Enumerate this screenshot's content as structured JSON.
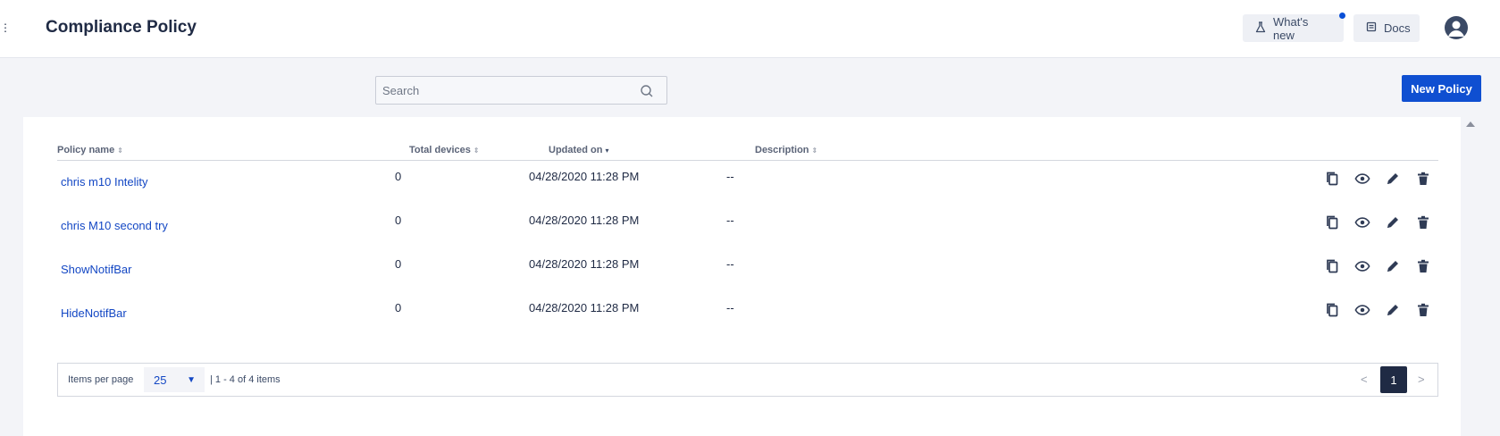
{
  "header": {
    "title": "Compliance Policy",
    "whats_new_label": "What's new",
    "docs_label": "Docs"
  },
  "toolbar": {
    "search_placeholder": "Search",
    "search_value": "",
    "new_policy_label": "New Policy"
  },
  "table": {
    "columns": [
      {
        "label": "Policy name",
        "sort": "none"
      },
      {
        "label": "Total devices",
        "sort": "none"
      },
      {
        "label": "Updated on",
        "sort": "descending"
      },
      {
        "label": "Description",
        "sort": "none"
      }
    ],
    "rows": [
      {
        "name": "chris m10 Intelity",
        "devices": "0",
        "updated": "04/28/2020 11:28 PM",
        "description": "--"
      },
      {
        "name": "chris M10 second try",
        "devices": "0",
        "updated": "04/28/2020 11:28 PM",
        "description": "--"
      },
      {
        "name": "ShowNotifBar",
        "devices": "0",
        "updated": "04/28/2020 11:28 PM",
        "description": "--"
      },
      {
        "name": "HideNotifBar",
        "devices": "0",
        "updated": "04/28/2020 11:28 PM",
        "description": "--"
      }
    ],
    "row_actions": [
      "copy-icon",
      "view-icon",
      "edit-icon",
      "delete-icon"
    ]
  },
  "pagination": {
    "items_per_page_label": "Items per page",
    "items_per_page_value": "25",
    "range_text": "| 1 - 4 of 4 items",
    "current_page": "1",
    "prev_symbol": "<",
    "next_symbol": ">"
  },
  "colors": {
    "primary": "#0f4fd1",
    "link": "#1347c4",
    "text_dark": "#1f2a44",
    "background": "#f3f4f8"
  }
}
